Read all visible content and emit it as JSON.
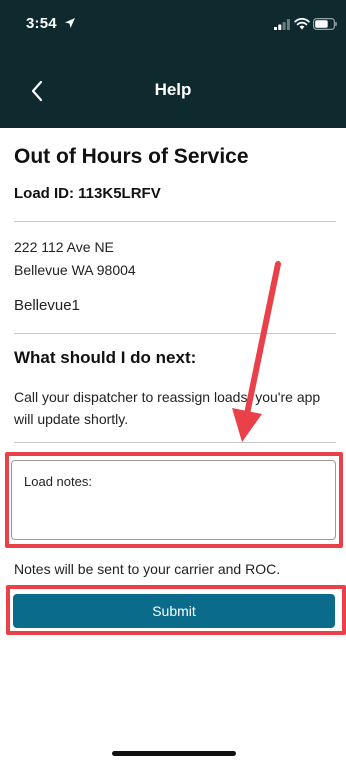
{
  "status_bar": {
    "time": "3:54"
  },
  "nav": {
    "title": "Help"
  },
  "content": {
    "title": "Out of Hours of Service",
    "load_id": "Load ID: 113K5LRFV",
    "address_line1": "222 112 Ave NE",
    "address_line2": "Bellevue WA 98004",
    "site_name": "Bellevue1",
    "next_heading": "What should I do next:",
    "next_body": "Call your dispatcher to reassign loads, you're app will update shortly."
  },
  "form": {
    "notes_label": "Load notes:",
    "notes_hint": "Notes will be sent to your carrier and ROC.",
    "submit_label": "Submit"
  },
  "icons": {
    "back": "chevron-left-icon",
    "location": "location-arrow-icon",
    "signal": "cellular-signal-icon",
    "wifi": "wifi-icon",
    "battery": "battery-icon",
    "annotation": "red-arrow-annotation"
  },
  "colors": {
    "header_bg": "#0f2a2f",
    "submit_bg": "#0a6b8a",
    "annotation_red": "#ea4049"
  }
}
